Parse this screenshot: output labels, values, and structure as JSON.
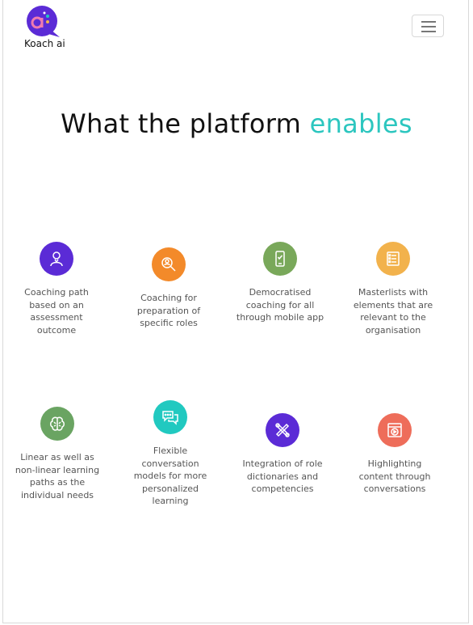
{
  "brand": {
    "logo_text": "Koach ai",
    "logo_mark": "ai"
  },
  "section": {
    "title_main": "What the platform ",
    "title_accent": "enables",
    "accent_color": "#2cc6bf"
  },
  "features": [
    {
      "label": "Coaching path based on an assessment outcome",
      "icon": "person-path-icon",
      "color": "#5b2bd6"
    },
    {
      "label": "Coaching for preparation of specific roles",
      "icon": "magnifier-person-icon",
      "color": "#f38a2a"
    },
    {
      "label": "Democratised coaching for all through mobile app",
      "icon": "mobile-app-icon",
      "color": "#79a85a"
    },
    {
      "label": "Masterlists with elements that are relevant to the organisation",
      "icon": "checklist-icon",
      "color": "#f2b24c"
    },
    {
      "label": "Linear as well as non-linear learning paths as the individual needs",
      "icon": "brain-icon",
      "color": "#6aa462"
    },
    {
      "label": "Flexible conversation models for more personalized learning",
      "icon": "chat-bubbles-icon",
      "color": "#21c9c0"
    },
    {
      "label": "Integration of role dictionaries and competencies",
      "icon": "tools-icon",
      "color": "#5b2bd6"
    },
    {
      "label": "Highlighting content through conversations",
      "icon": "video-content-icon",
      "color": "#ee6d5a"
    }
  ]
}
